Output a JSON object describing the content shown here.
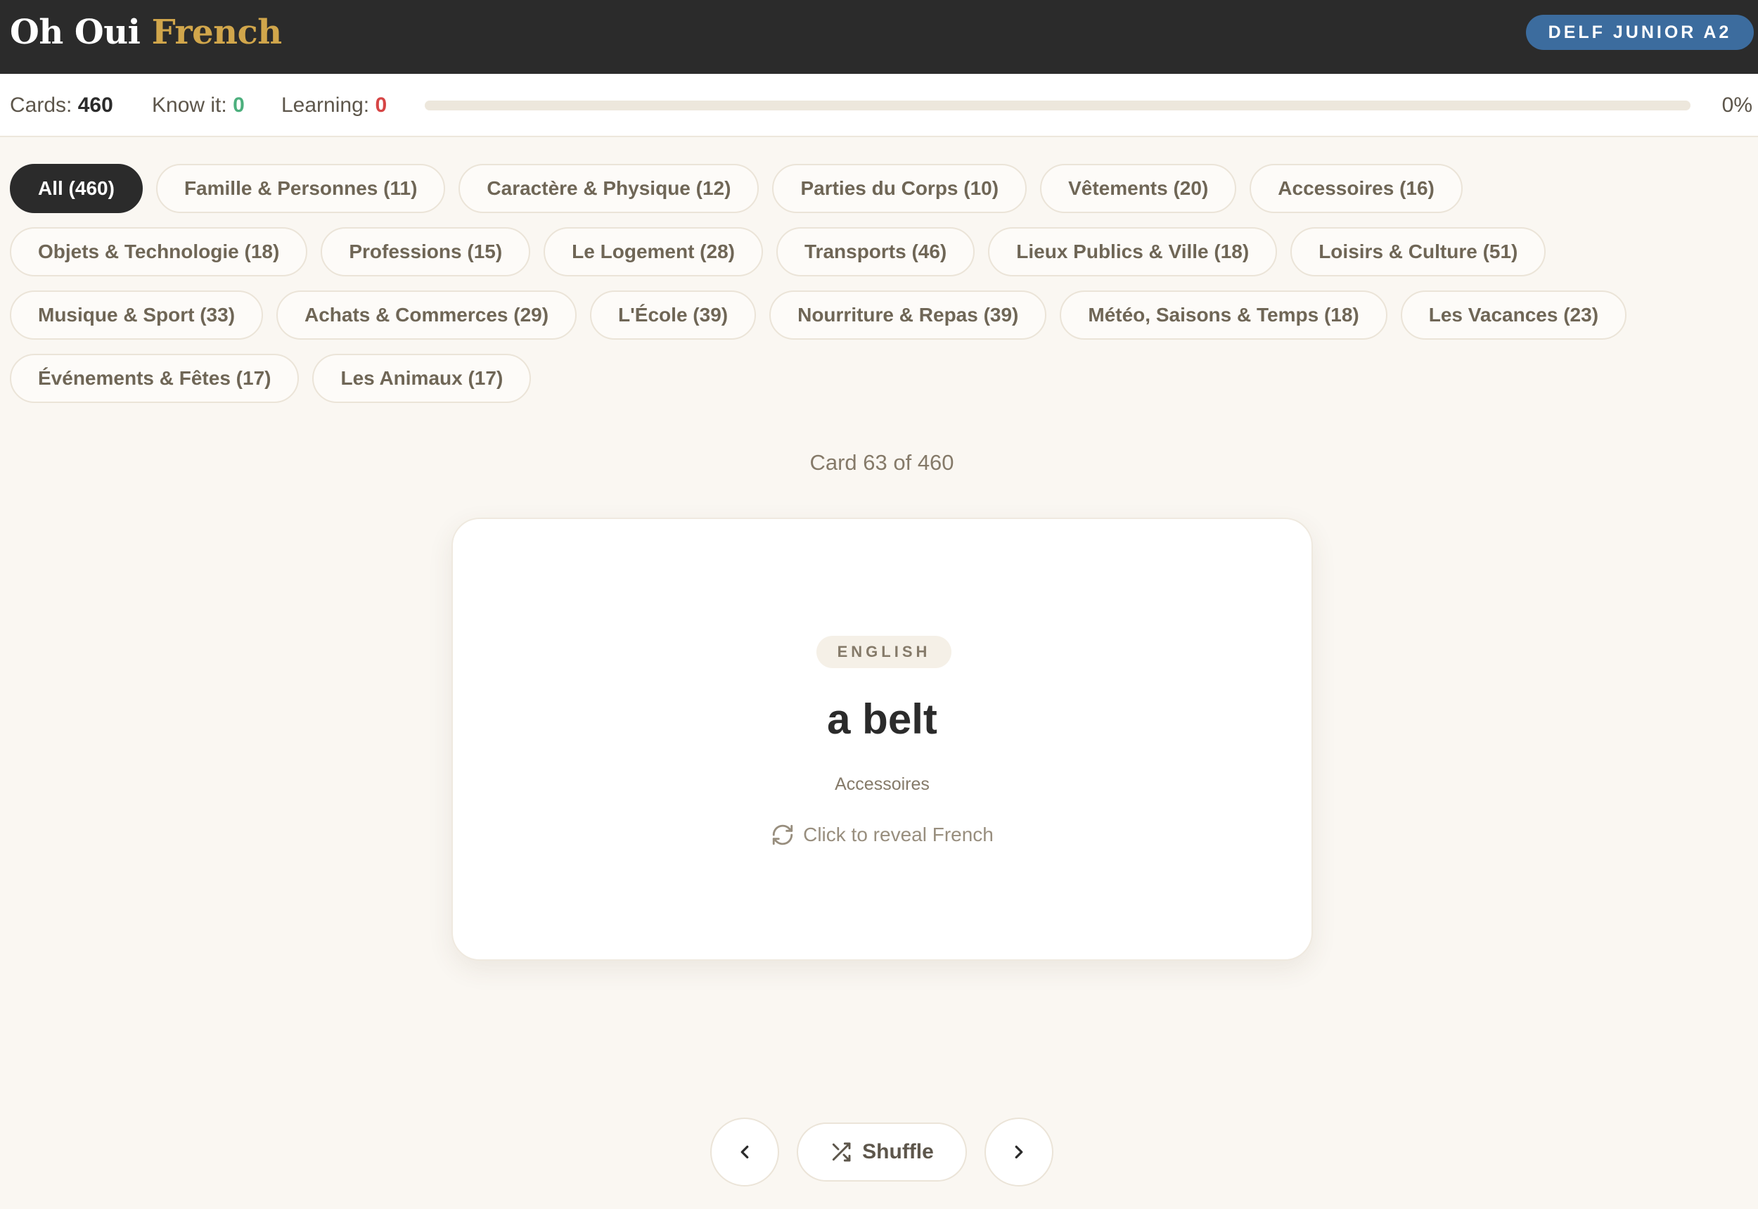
{
  "header": {
    "logo_part1": "Oh Oui",
    "logo_part2": "French",
    "level_badge": "DELF JUNIOR A2",
    "colors": {
      "background": "#2b2b2b",
      "logo_accent": "#d1a64b",
      "badge": "#3c6c9e"
    }
  },
  "stats": {
    "cards_label": "Cards:",
    "cards_value": "460",
    "know_label": "Know it:",
    "know_value": "0",
    "learning_label": "Learning:",
    "learning_value": "0",
    "progress_fraction": 0,
    "progress_text": "0%",
    "colors": {
      "know": "#4caf7d",
      "learning": "#d64545"
    }
  },
  "categories": [
    {
      "label": "All (460)",
      "active": true
    },
    {
      "label": "Famille & Personnes (11)"
    },
    {
      "label": "Caractère & Physique (12)"
    },
    {
      "label": "Parties du Corps (10)"
    },
    {
      "label": "Vêtements (20)"
    },
    {
      "label": "Accessoires (16)"
    },
    {
      "label": "Objets & Technologie (18)"
    },
    {
      "label": "Professions (15)"
    },
    {
      "label": "Le Logement (28)"
    },
    {
      "label": "Transports (46)"
    },
    {
      "label": "Lieux Publics & Ville (18)"
    },
    {
      "label": "Loisirs & Culture (51)"
    },
    {
      "label": "Musique & Sport (33)"
    },
    {
      "label": "Achats & Commerces (29)"
    },
    {
      "label": "L'École (39)"
    },
    {
      "label": "Nourriture & Repas (39)"
    },
    {
      "label": "Météo, Saisons & Temps (18)"
    },
    {
      "label": "Les Vacances (23)"
    },
    {
      "label": "Événements & Fêtes (17)"
    },
    {
      "label": "Les Animaux (17)"
    }
  ],
  "card": {
    "counter": "Card 63 of 460",
    "language": "ENGLISH",
    "word": "a belt",
    "category": "Accessoires",
    "reveal_hint": "Click to reveal French",
    "reveal_icon": "refresh-icon"
  },
  "controls": {
    "prev_icon": "chevron-left-icon",
    "shuffle_label": "Shuffle",
    "shuffle_icon": "shuffle-icon",
    "next_icon": "chevron-right-icon"
  }
}
